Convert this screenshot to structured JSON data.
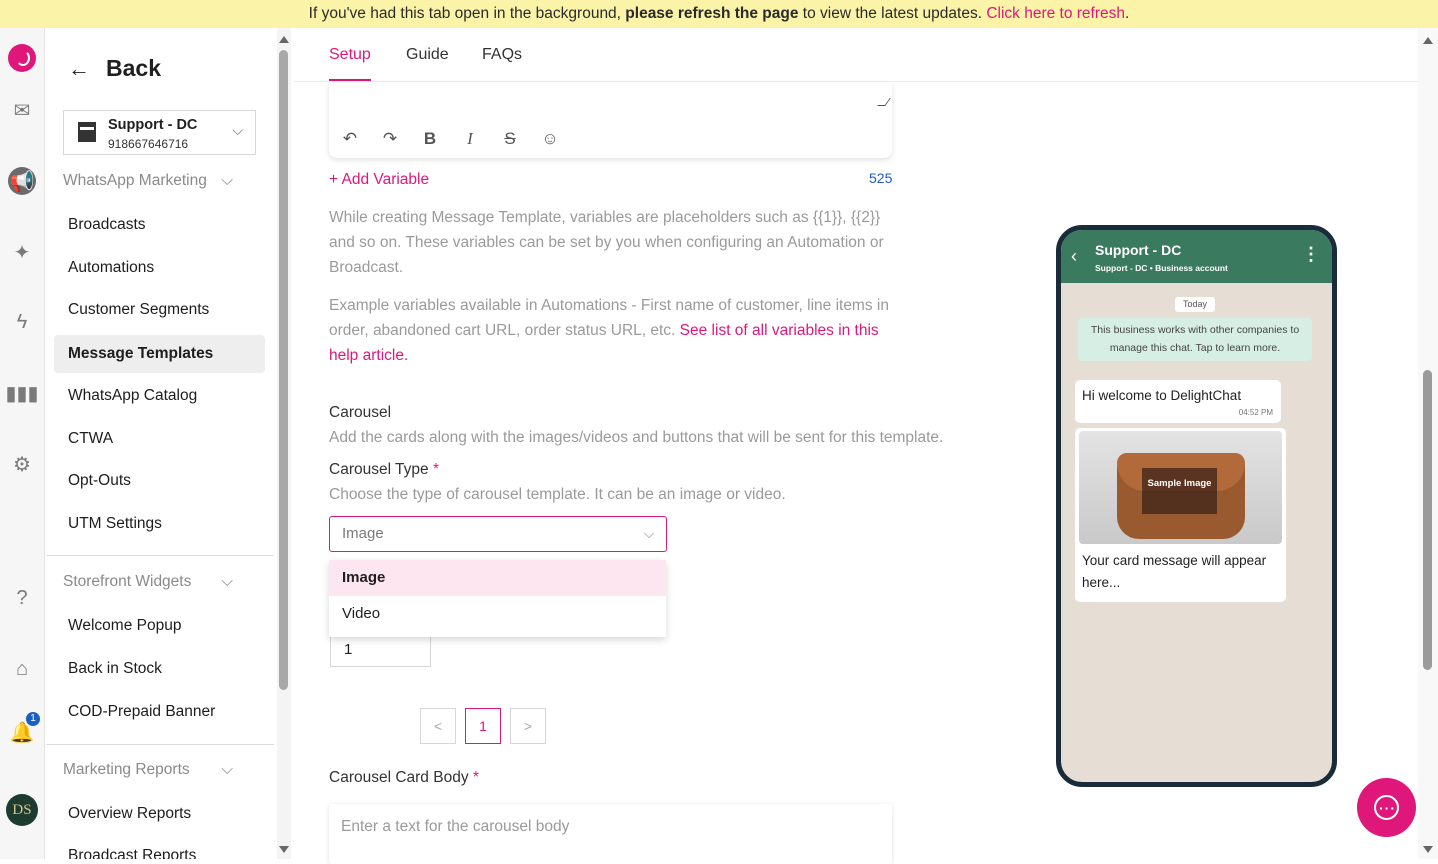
{
  "banner": {
    "prefix": "If you've had this tab open in the background, ",
    "bold": "please refresh the page",
    "middle": " to view the latest updates. ",
    "link": "Click here to refresh",
    "suffix": "."
  },
  "rail": {
    "notification_count": "1",
    "avatar_initials": "DS",
    "icons": [
      "app-logo-icon",
      "mail-icon",
      "megaphone-icon",
      "sparkles-icon",
      "lightning-icon",
      "bar-chart-icon",
      "gear-icon",
      "help-icon",
      "home-icon",
      "bell-icon"
    ]
  },
  "sidebar": {
    "back_label": "Back",
    "store": {
      "name": "Support - DC",
      "number": "918667646716"
    },
    "sections": [
      {
        "title": "WhatsApp Marketing",
        "items": [
          "Broadcasts",
          "Automations",
          "Customer Segments",
          "Message Templates",
          "WhatsApp Catalog",
          "CTWA",
          "Opt-Outs",
          "UTM Settings"
        ]
      },
      {
        "title": "Storefront Widgets",
        "items": [
          "Welcome Popup",
          "Back in Stock",
          "COD-Prepaid Banner"
        ]
      },
      {
        "title": "Marketing Reports",
        "items": [
          "Overview Reports",
          "Broadcast Reports"
        ]
      }
    ],
    "selected": "Message Templates"
  },
  "tabs": [
    "Setup",
    "Guide",
    "FAQs"
  ],
  "active_tab": "Setup",
  "editor": {
    "tools": [
      "undo",
      "redo",
      "B",
      "I",
      "S",
      "emoji"
    ],
    "add_variable": "+ Add Variable",
    "char_count": "525"
  },
  "help_text": {
    "variables": "While creating Message Template, variables are placeholders such as {{1}}, {{2}} and so on. These variables can be set by you when configuring an Automation or Broadcast.",
    "examples": "Example variables available in Automations - First name of customer, line items in order, abandoned cart URL, order status URL, etc. ",
    "examples_link": "See list of all variables in this help article."
  },
  "carousel": {
    "title": "Carousel",
    "description": "Add the cards along with the images/videos and buttons that will be sent for this template.",
    "type_label": "Carousel Type",
    "type_help": "Choose the type of carousel template. It can be an image or video.",
    "type_value": "Image",
    "type_options": [
      "Image",
      "Video"
    ],
    "card_count": "1",
    "page_prev": "<",
    "page_current": "1",
    "page_next": ">",
    "body_label": "Carousel Card Body",
    "body_placeholder": "Enter a text for the carousel body",
    "required_mark": "*"
  },
  "preview": {
    "name": "Support - DC",
    "subtitle": "Support - DC • Business account",
    "date_chip": "Today",
    "notice": "This business works with other companies to manage this chat. Tap to learn more.",
    "message": "Hi welcome to DelightChat",
    "time": "04:52 PM",
    "sample_label": "Sample Image",
    "card_message": "Your card message will appear here..."
  },
  "colors": {
    "accent": "#e0177a",
    "banner": "#fbf3a8",
    "wa_green": "#3a7a5e"
  }
}
